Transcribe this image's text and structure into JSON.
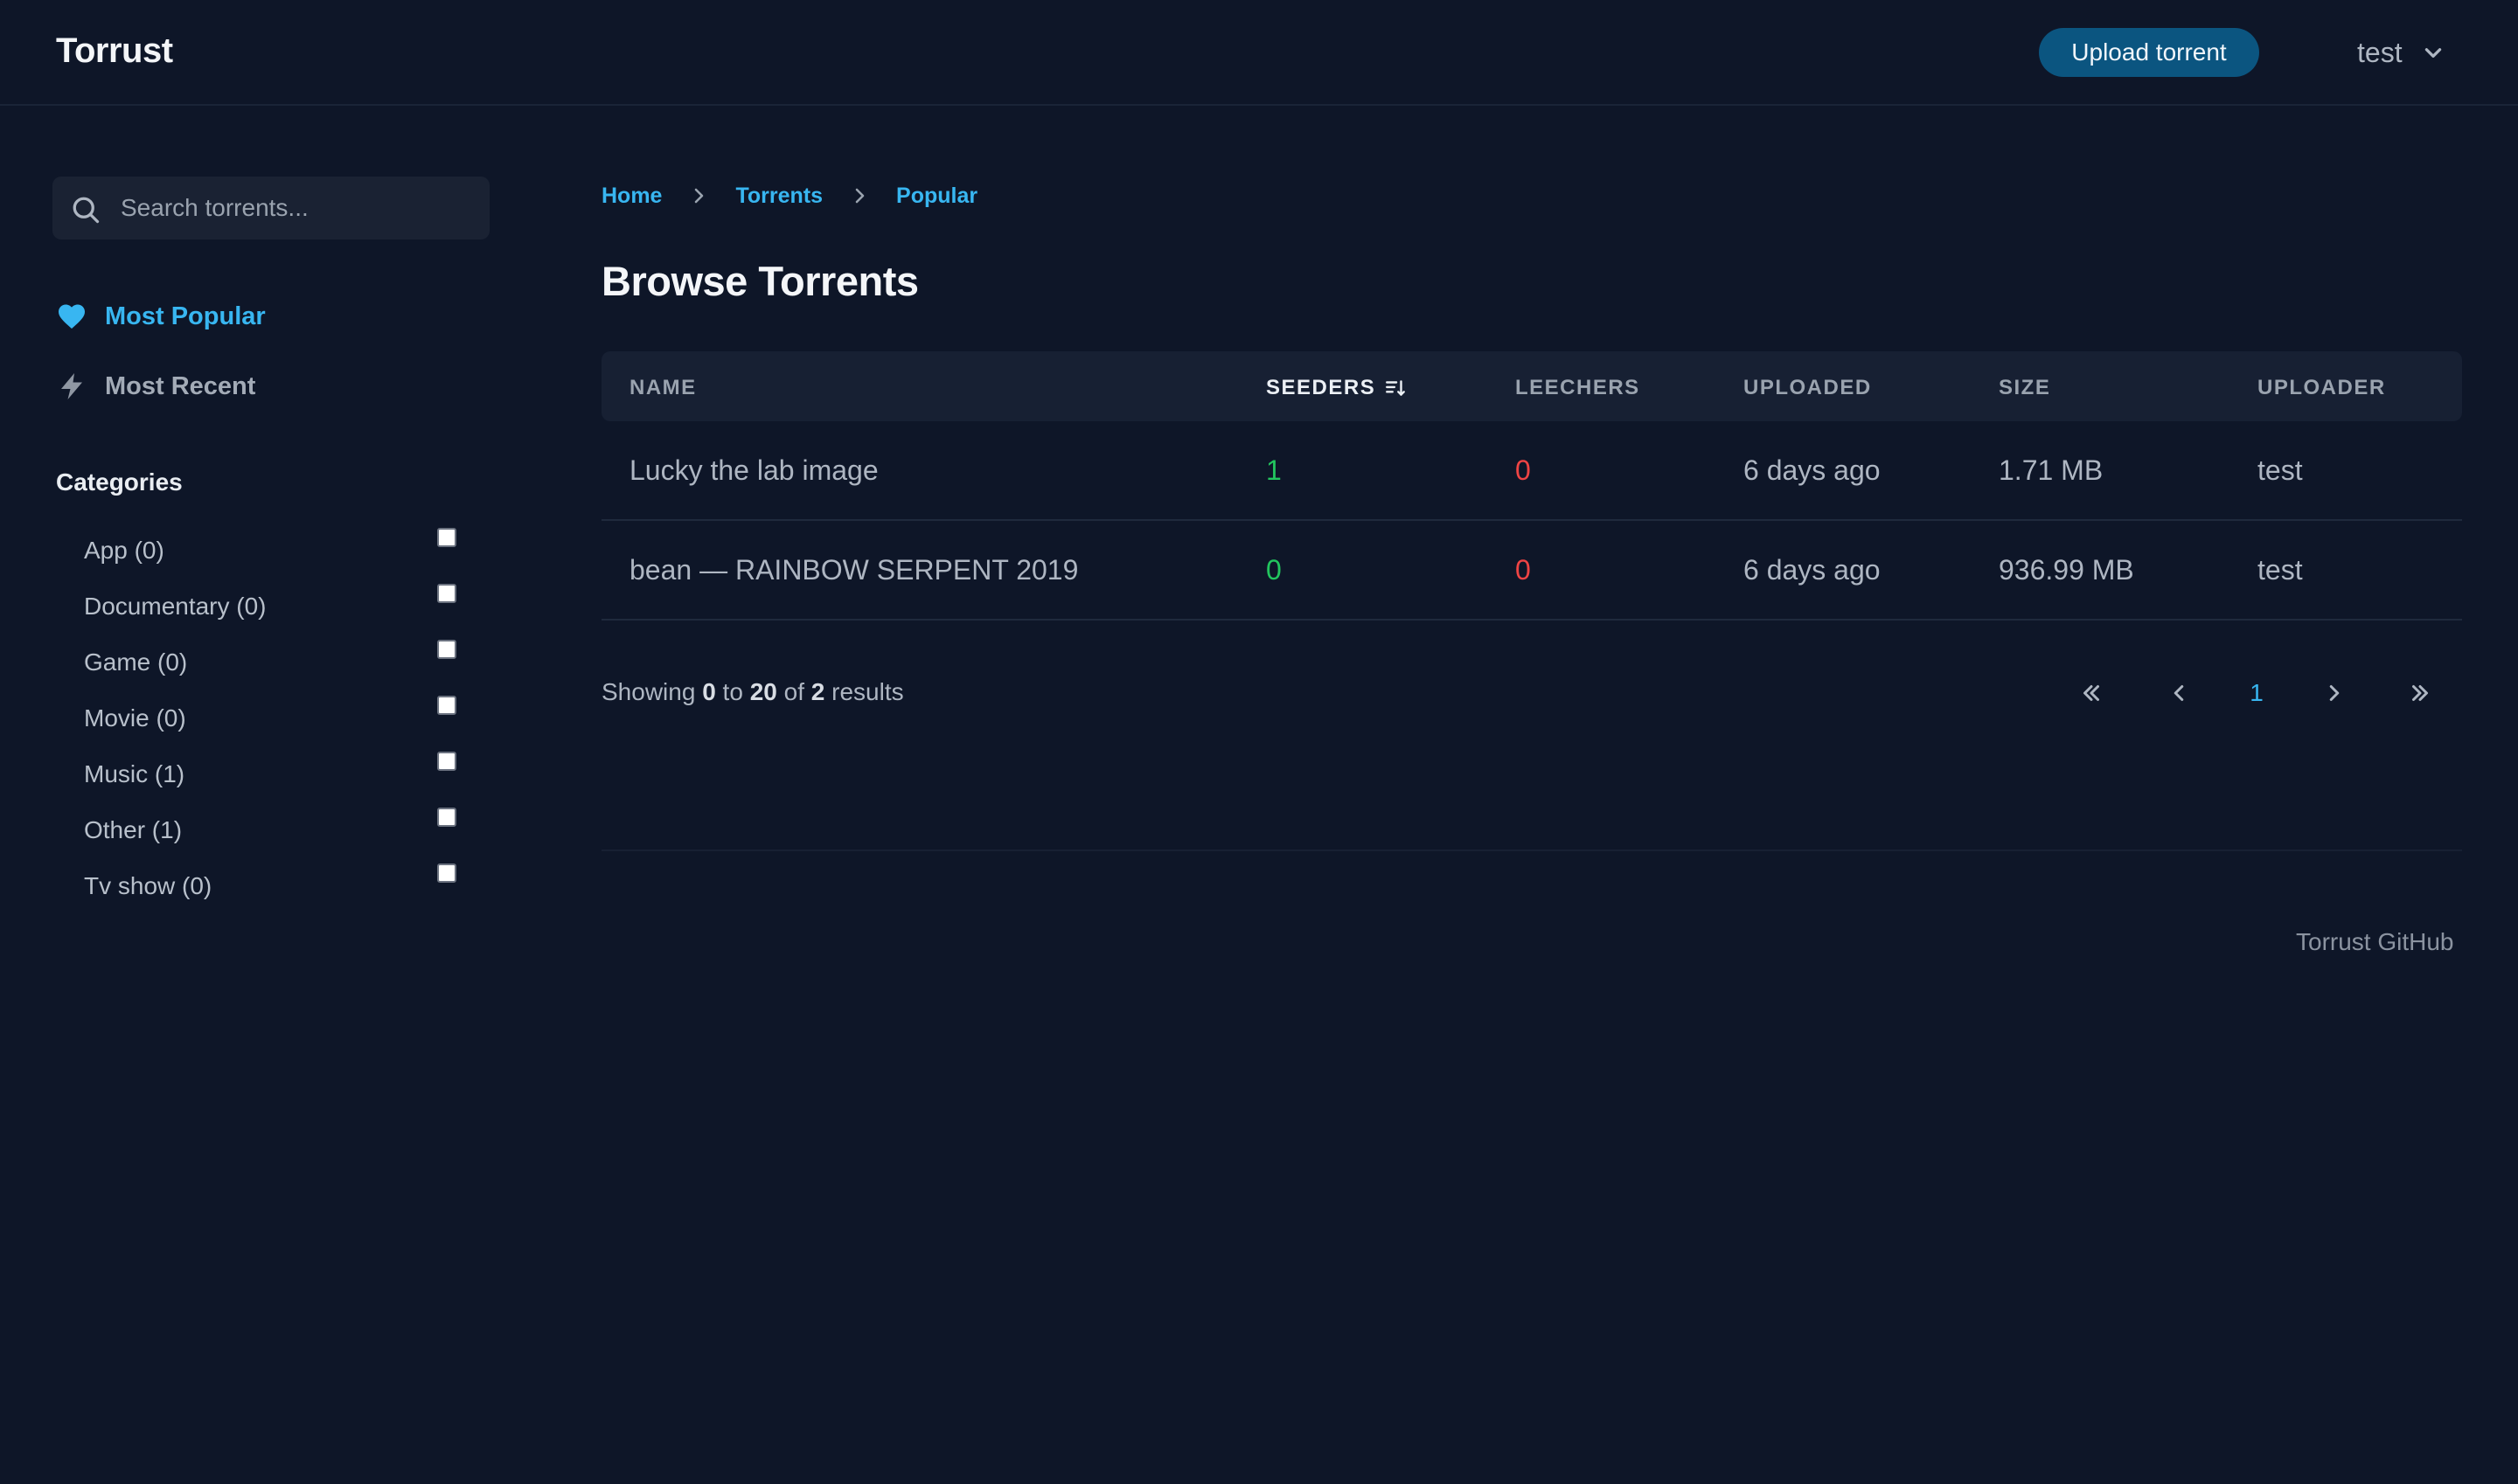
{
  "header": {
    "logo": "Torrust",
    "upload_label": "Upload torrent",
    "user_name": "test"
  },
  "sidebar": {
    "search_placeholder": "Search torrents...",
    "nav": [
      {
        "label": "Most Popular",
        "icon": "heart-icon",
        "active": true
      },
      {
        "label": "Most Recent",
        "icon": "bolt-icon",
        "active": false
      }
    ],
    "categories_title": "Categories",
    "categories": [
      {
        "label": "App (0)",
        "checked": false
      },
      {
        "label": "Documentary (0)",
        "checked": false
      },
      {
        "label": "Game (0)",
        "checked": false
      },
      {
        "label": "Movie (0)",
        "checked": false
      },
      {
        "label": "Music (1)",
        "checked": false
      },
      {
        "label": "Other (1)",
        "checked": false
      },
      {
        "label": "Tv show (0)",
        "checked": false
      }
    ]
  },
  "breadcrumb": [
    "Home",
    "Torrents",
    "Popular"
  ],
  "page_title": "Browse Torrents",
  "table": {
    "columns": [
      "NAME",
      "SEEDERS",
      "LEECHERS",
      "UPLOADED",
      "SIZE",
      "UPLOADER"
    ],
    "sorted_column": "SEEDERS",
    "rows": [
      {
        "name": "Lucky the lab image",
        "seeders": "1",
        "leechers": "0",
        "uploaded": "6 days ago",
        "size": "1.71 MB",
        "uploader": "test"
      },
      {
        "name": "bean — RAINBOW SERPENT 2019",
        "seeders": "0",
        "leechers": "0",
        "uploaded": "6 days ago",
        "size": "936.99 MB",
        "uploader": "test"
      }
    ]
  },
  "results": {
    "prefix": "Showing",
    "from": "0",
    "to_word": "to",
    "to": "20",
    "of_word": "of",
    "total": "2",
    "suffix": "results"
  },
  "pagination": {
    "current_page": "1"
  },
  "footer": {
    "link": "Torrust GitHub"
  },
  "colors": {
    "background": "#0e1628",
    "accent": "#38b6f1",
    "button": "#0b5580",
    "seeders": "#22c55e",
    "leechers": "#ef4444"
  }
}
